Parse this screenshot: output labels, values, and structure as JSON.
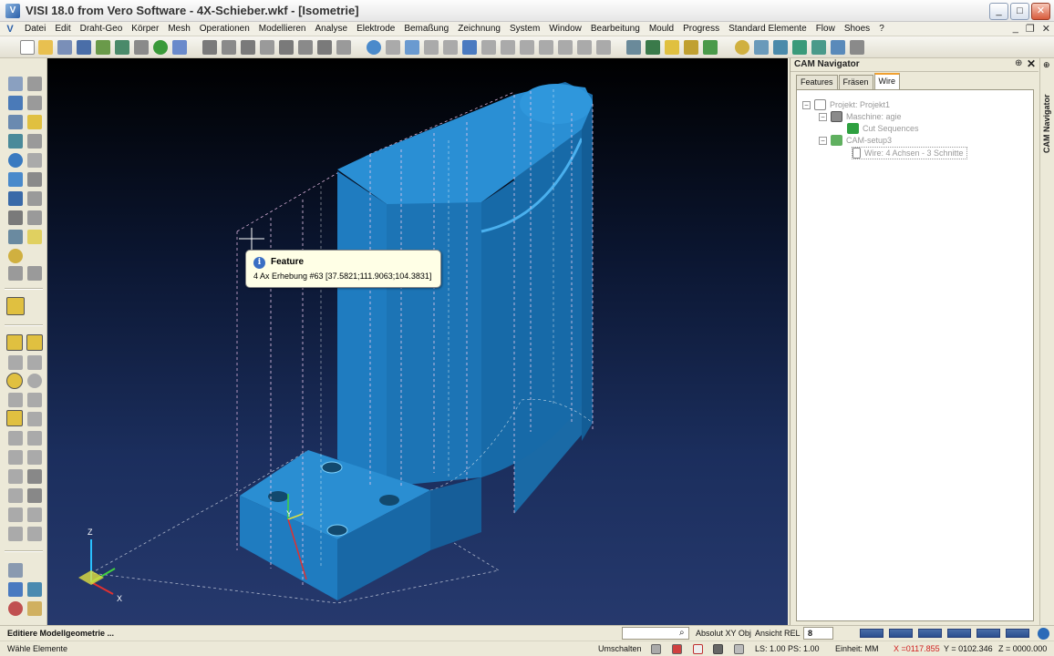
{
  "window": {
    "title": "VISI 18.0 from Vero Software - 4X-Schieber.wkf - [Isometrie]",
    "app_icon": "V",
    "minimize": "_",
    "maximize": "□",
    "close": "✕"
  },
  "menu": {
    "items": [
      "Datei",
      "Edit",
      "Draht-Geo",
      "Körper",
      "Mesh",
      "Operationen",
      "Modellieren",
      "Analyse",
      "Elektrode",
      "Bemaßung",
      "Zeichnung",
      "System",
      "Window",
      "Bearbeitung",
      "Mould",
      "Progress",
      "Standard Elemente",
      "Flow",
      "Shoes",
      "?"
    ],
    "mdi_minimize": "_",
    "mdi_restore": "❐",
    "mdi_close": "✕"
  },
  "tooltip": {
    "title": "Feature",
    "body": "4 Ax Erhebung #63 [37.5821;111.9063;104.3831]",
    "icon": "i"
  },
  "cam_navigator": {
    "title": "CAM Navigator",
    "pin": "⊕",
    "close": "✕",
    "side_title": "CAM Navigator",
    "tabs": [
      "Features",
      "Fräsen",
      "Wire"
    ],
    "active_tab": "Wire",
    "tree": {
      "project": "Projekt: Projekt1",
      "machine": "Maschine: agie",
      "sequences": "Cut Sequences",
      "setup": "CAM-setup3",
      "wire": "Wire: 4 Achsen - 3 Schnitte",
      "toggle_minus": "−"
    }
  },
  "status": {
    "message": "Editiere Modellgeometrie ...",
    "hint": "Wähle Elemente",
    "absolute_label": "Absolut XY Obj",
    "view_label": "Ansicht REL",
    "view_value": "8",
    "switch_label": "Umschalten",
    "ls_ps": "LS: 1.00 PS: 1.00",
    "unit": "Einheit: MM",
    "coord_x": "X =0117.855",
    "coord_y": "Y = 0102.346",
    "coord_z": "Z = 0000.000"
  },
  "viewport": {
    "axis_z": "Z",
    "axis_y": "Y",
    "axis_x": "X",
    "part_color": "#1e7fbf"
  }
}
